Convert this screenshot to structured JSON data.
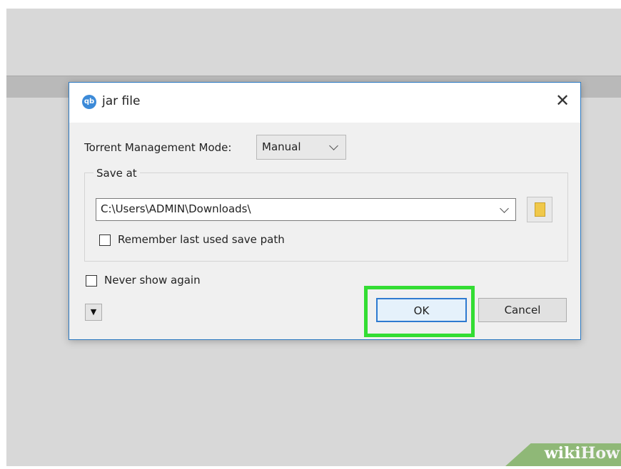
{
  "dialog": {
    "icon_text": "qb",
    "title": "jar file",
    "close_glyph": "✕",
    "torrent_mode": {
      "label": "Torrent Management Mode:",
      "value": "Manual"
    },
    "save_at": {
      "title": "Save at",
      "path": "C:\\Users\\ADMIN\\Downloads\\",
      "remember_label": "Remember last used save path",
      "remember_checked": false
    },
    "never_show_label": "Never show again",
    "never_show_checked": false,
    "expand_glyph": "▼",
    "ok_label": "OK",
    "cancel_label": "Cancel"
  },
  "watermark": {
    "part1": "wiki",
    "part2": "How"
  },
  "colors": {
    "dialog_border": "#2b79c2",
    "highlight": "#33dd33",
    "folder_icon": "#f0c84a"
  }
}
